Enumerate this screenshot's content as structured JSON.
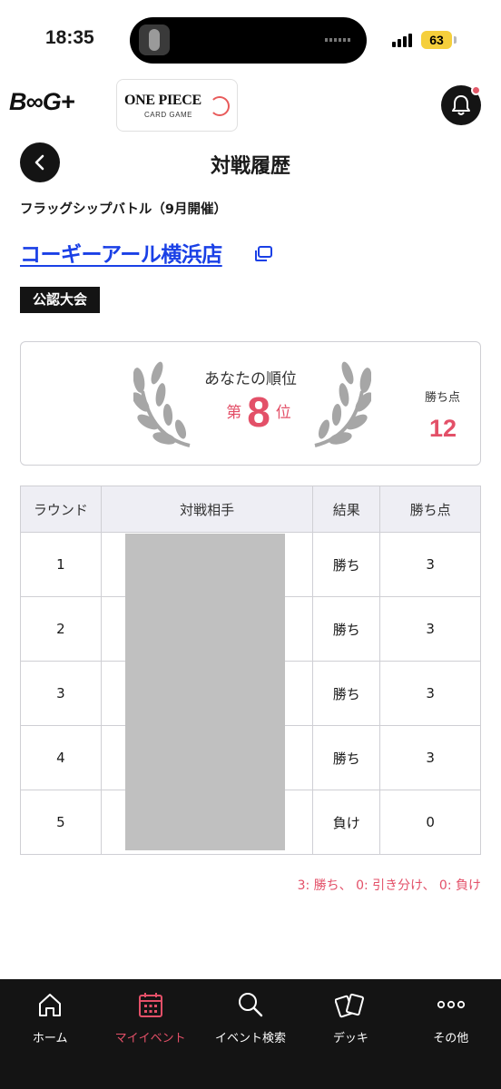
{
  "status_bar": {
    "time": "18:35",
    "battery": "63"
  },
  "header": {
    "bandai_logo": "B∞G+",
    "op_logo_title": "ONE PIECE",
    "op_logo_subtitle": "CARD GAME"
  },
  "page": {
    "title": "対戦履歴",
    "event_name": "フラッグシップバトル（9月開催）",
    "store_name": "コーギーアール横浜店",
    "badge": "公認大会"
  },
  "rank": {
    "caption": "あなたの順位",
    "prefix": "第",
    "value": "8",
    "suffix": "位",
    "points_label": "勝ち点",
    "points_value": "12"
  },
  "table": {
    "headers": [
      "ラウンド",
      "対戦相手",
      "結果",
      "勝ち点"
    ],
    "rows": [
      {
        "round": "1",
        "opponent": "",
        "result": "勝ち",
        "points": "3"
      },
      {
        "round": "2",
        "opponent": "",
        "result": "勝ち",
        "points": "3"
      },
      {
        "round": "3",
        "opponent": "",
        "result": "勝ち",
        "points": "3"
      },
      {
        "round": "4",
        "opponent": "",
        "result": "勝ち",
        "points": "3"
      },
      {
        "round": "5",
        "opponent": "",
        "result": "負け",
        "points": "0"
      }
    ]
  },
  "points_legend": "3: 勝ち、 0: 引き分け、 0: 負け",
  "nav": {
    "items": [
      {
        "label": "ホーム",
        "icon": "home-icon"
      },
      {
        "label": "マイイベント",
        "icon": "calendar-icon"
      },
      {
        "label": "イベント検索",
        "icon": "search-icon"
      },
      {
        "label": "デッキ",
        "icon": "cards-icon"
      },
      {
        "label": "その他",
        "icon": "more-icon"
      }
    ],
    "active_index": 1
  },
  "colors": {
    "accent": "#e35068",
    "link": "#1a40e6",
    "dark": "#141414"
  }
}
